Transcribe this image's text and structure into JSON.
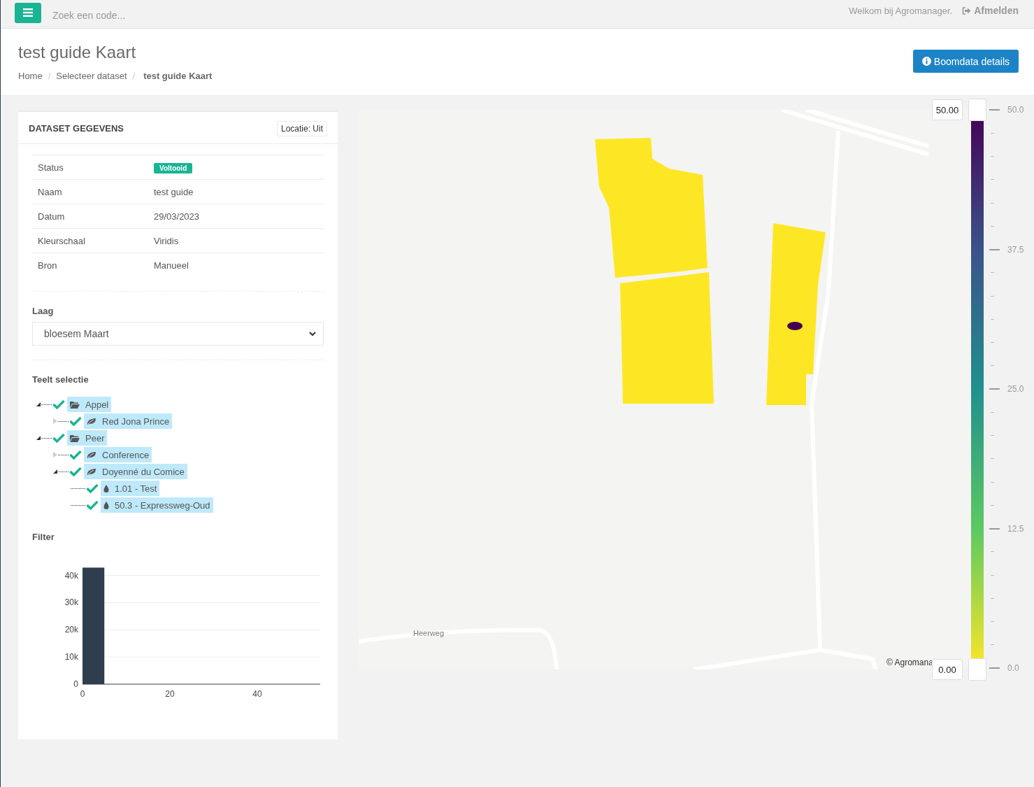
{
  "topbar": {
    "search_placeholder": "Zoek een code...",
    "welcome": "Welkom bij Agromanager.",
    "logout": "Afmelden"
  },
  "header": {
    "title": "test guide Kaart",
    "breadcrumbs": [
      {
        "label": "Home",
        "current": false
      },
      {
        "label": "Selecteer dataset",
        "current": false
      },
      {
        "label": "test guide Kaart",
        "current": true
      }
    ],
    "separator": "/",
    "button": "Boomdata details"
  },
  "dataset": {
    "title": "DATASET GEGEVENS",
    "location_button": "Locatie: Uit",
    "rows": [
      {
        "label": "Status",
        "value": "Voltooid",
        "kind": "badge"
      },
      {
        "label": "Naam",
        "value": "test guide",
        "kind": "text"
      },
      {
        "label": "Datum",
        "value": "29/03/2023",
        "kind": "text"
      },
      {
        "label": "Kleurschaal",
        "value": "Viridis",
        "kind": "text"
      },
      {
        "label": "Bron",
        "value": "Manueel",
        "kind": "text"
      }
    ],
    "layer_label": "Laag",
    "layer_value": "bloesem Maart",
    "tree_label": "Teelt selectie",
    "tree": [
      {
        "label": "Appel",
        "kind": "group",
        "expanded": true,
        "checked": true,
        "selected": true,
        "children": [
          {
            "label": "Red Jona Prince",
            "kind": "variety",
            "expanded": false,
            "checked": true,
            "selected": true
          }
        ]
      },
      {
        "label": "Peer",
        "kind": "group",
        "expanded": true,
        "checked": true,
        "selected": true,
        "children": [
          {
            "label": "Conference",
            "kind": "variety",
            "expanded": false,
            "checked": true,
            "selected": true
          },
          {
            "label": "Doyenné du Comice",
            "kind": "variety",
            "expanded": true,
            "checked": true,
            "selected": true,
            "children": [
              {
                "label": "1.01 - Test",
                "kind": "plot",
                "checked": true,
                "selected": true
              },
              {
                "label": "50.3 - Expressweg-Oud",
                "kind": "plot",
                "checked": true,
                "selected": true
              }
            ]
          }
        ]
      }
    ],
    "filter_label": "Filter",
    "chart_data": {
      "type": "bar",
      "grid": true,
      "x": [
        2.5
      ],
      "values": [
        42900
      ],
      "xlim": [
        0,
        54.4
      ],
      "ylim": [
        0,
        43000
      ],
      "xticks": [
        0,
        20,
        40
      ],
      "yticks": [
        0,
        {
          "value": 10000,
          "label": "10k"
        },
        {
          "value": 20000,
          "label": "20k"
        },
        {
          "value": 30000,
          "label": "30k"
        },
        {
          "value": 40000,
          "label": "40k"
        }
      ]
    }
  },
  "map": {
    "road_label": "Heerweg",
    "attribution": "© Agromana"
  },
  "scale": {
    "handles": [
      {
        "value": "50.00",
        "level": 1
      },
      {
        "value": "0.00",
        "level": 0
      }
    ],
    "labels": [
      "50.0",
      "37.5",
      "25.0",
      "12.5",
      "0.0"
    ]
  }
}
